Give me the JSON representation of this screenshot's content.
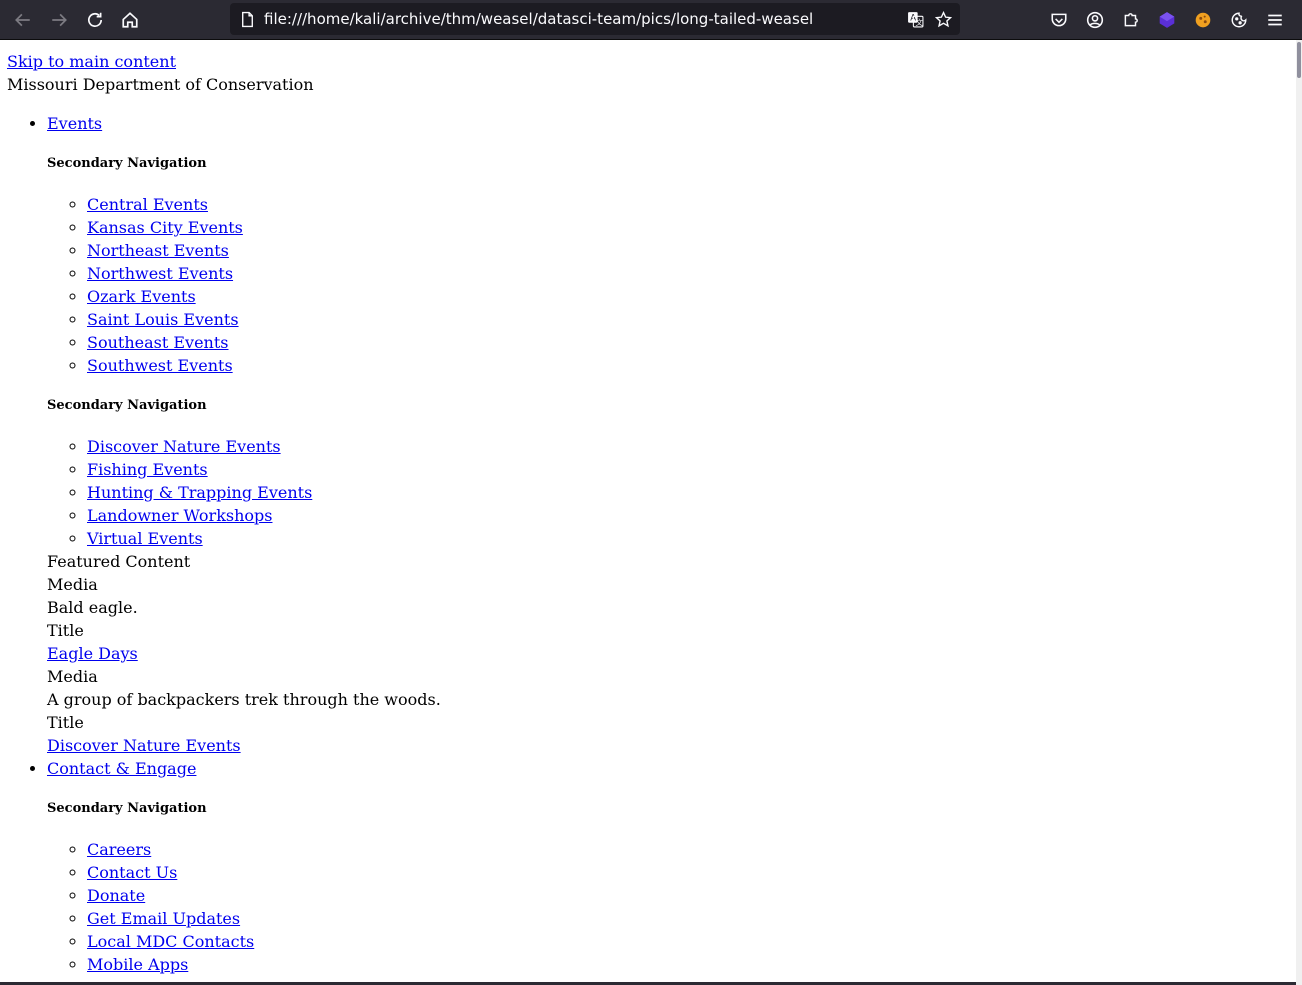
{
  "browser": {
    "url": "file:///home/kali/archive/thm/weasel/datasci-team/pics/long-tailed-weasel"
  },
  "page": {
    "skip_link": "Skip to main content",
    "site_name": "Missouri Department of Conservation",
    "menu": {
      "events": {
        "label": "Events",
        "secnav_heading_1": "Secondary Navigation",
        "regions": [
          "Central Events",
          "Kansas City Events",
          "Northeast Events",
          "Northwest Events",
          "Ozark Events",
          "Saint Louis Events",
          "Southeast Events",
          "Southwest Events"
        ],
        "secnav_heading_2": "Secondary Navigation",
        "types": [
          "Discover Nature Events",
          "Fishing Events",
          "Hunting & Trapping Events",
          "Landowner Workshops",
          "Virtual Events"
        ],
        "featured": {
          "heading": "Featured Content",
          "items": [
            {
              "media_label": "Media",
              "image_alt": "Bald eagle.",
              "title_label": "Title",
              "title_link": "Eagle Days"
            },
            {
              "media_label": "Media",
              "image_alt": "A group of backpackers trek through the woods.",
              "title_label": "Title",
              "title_link": "Discover Nature Events"
            }
          ]
        }
      },
      "contact": {
        "label": "Contact & Engage",
        "secnav_heading": "Secondary Navigation",
        "links": [
          "Careers",
          "Contact Us",
          "Donate",
          "Get Email Updates",
          "Local MDC Contacts",
          "Mobile Apps"
        ]
      }
    }
  }
}
